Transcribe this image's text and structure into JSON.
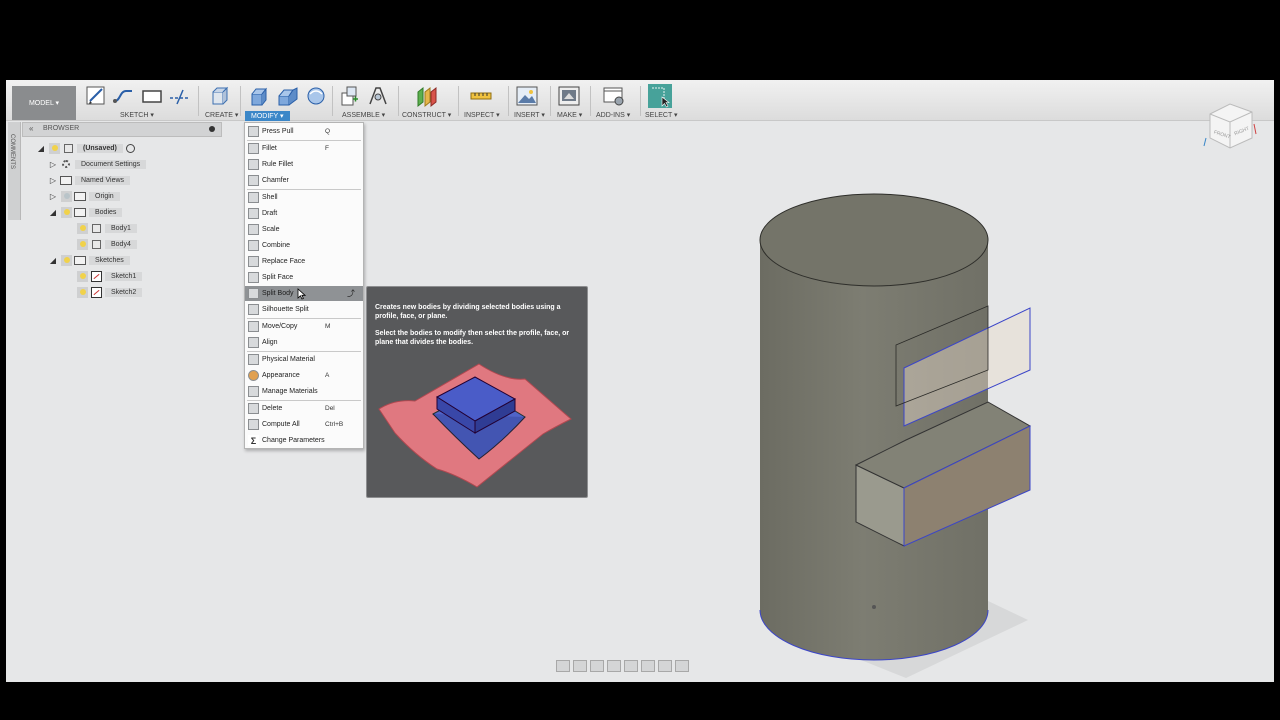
{
  "toolbar": {
    "model_label": "MODEL ▾",
    "groups": {
      "sketch": "SKETCH ▾",
      "create": "CREATE ▾",
      "modify": "MODIFY ▾",
      "assemble": "ASSEMBLE ▾",
      "construct": "CONSTRUCT ▾",
      "inspect": "INSPECT ▾",
      "insert": "INSERT ▾",
      "make": "MAKE ▾",
      "addins": "ADD-INS ▾",
      "select": "SELECT ▾"
    }
  },
  "comments_label": "COMMENTS",
  "browser": {
    "title": "BROWSER",
    "items": [
      {
        "label": "(Unsaved)"
      },
      {
        "label": "Document Settings"
      },
      {
        "label": "Named Views"
      },
      {
        "label": "Origin"
      },
      {
        "label": "Bodies"
      },
      {
        "label": "Body1"
      },
      {
        "label": "Body4"
      },
      {
        "label": "Sketches"
      },
      {
        "label": "Sketch1"
      },
      {
        "label": "Sketch2"
      }
    ]
  },
  "modify_menu": {
    "items": [
      {
        "label": "Press Pull",
        "key": "Q"
      },
      {
        "label": "Fillet",
        "key": "F"
      },
      {
        "label": "Rule Fillet",
        "key": ""
      },
      {
        "label": "Chamfer",
        "key": ""
      },
      {
        "label": "Shell",
        "key": ""
      },
      {
        "label": "Draft",
        "key": ""
      },
      {
        "label": "Scale",
        "key": ""
      },
      {
        "label": "Combine",
        "key": ""
      },
      {
        "label": "Replace Face",
        "key": ""
      },
      {
        "label": "Split Face",
        "key": ""
      },
      {
        "label": "Split Body",
        "key": ""
      },
      {
        "label": "Silhouette Split",
        "key": ""
      },
      {
        "label": "Move/Copy",
        "key": "M"
      },
      {
        "label": "Align",
        "key": ""
      },
      {
        "label": "Physical Material",
        "key": ""
      },
      {
        "label": "Appearance",
        "key": "A"
      },
      {
        "label": "Manage Materials",
        "key": ""
      },
      {
        "label": "Delete",
        "key": "Del"
      },
      {
        "label": "Compute All",
        "key": "Ctrl+B"
      },
      {
        "label": "Change Parameters",
        "key": ""
      }
    ]
  },
  "tooltip": {
    "line1": "Creates new bodies by dividing selected bodies using a profile, face, or plane.",
    "line2": "Select the bodies to modify then select the profile, face, or plane that divides the bodies."
  },
  "viewcube": {
    "front": "FRONT",
    "right": "RIGHT"
  },
  "colors": {
    "accent": "#3b87c8",
    "body": "#77776d",
    "split_plane": "#e8dccb",
    "edge_highlight": "#3b45c8"
  }
}
